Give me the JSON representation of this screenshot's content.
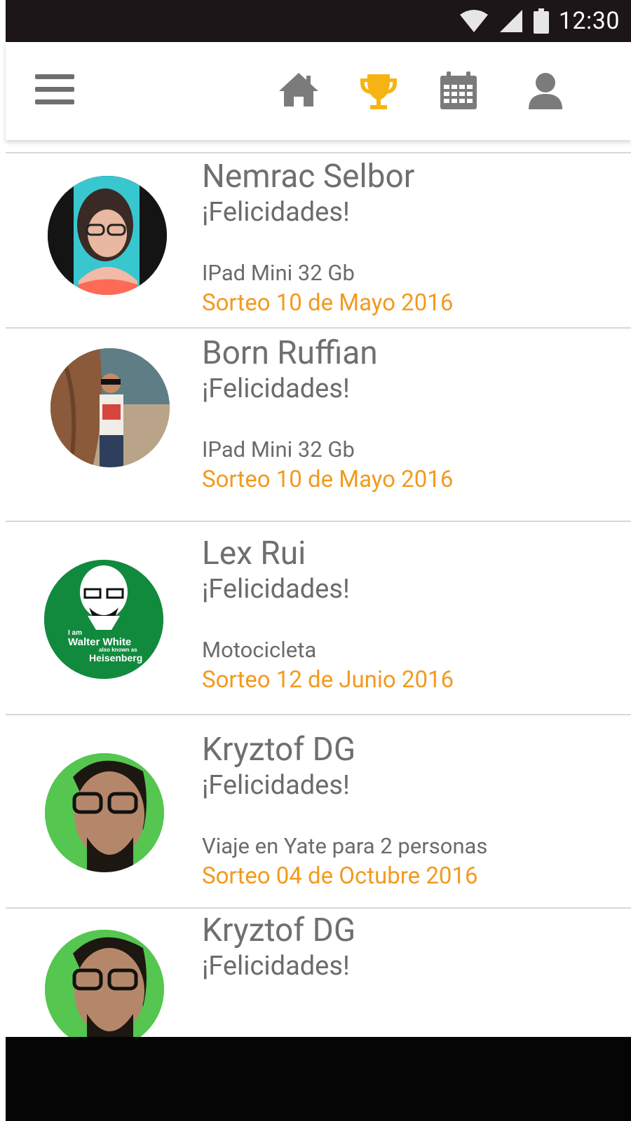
{
  "status_bar": {
    "time": "12:30"
  },
  "nav": {
    "active_tab": "winners",
    "active_color": "#f6b414",
    "inactive_color": "#7b7b7b",
    "items": [
      "menu-icon",
      "home-icon",
      "trophy-icon",
      "calendar-icon",
      "user-icon"
    ]
  },
  "winners": [
    {
      "name": "Nemrac Selbor",
      "message": "¡Felicidades!",
      "prize": "IPad Mini 32 Gb",
      "draw": "Sorteo 10 de Mayo 2016"
    },
    {
      "name": "Born Ruffian",
      "message": "¡Felicidades!",
      "prize": "IPad Mini 32 Gb",
      "draw": "Sorteo 10 de Mayo 2016"
    },
    {
      "name": "Lex Rui",
      "message": "¡Felicidades!",
      "prize": "Motocicleta",
      "draw": "Sorteo 12 de Junio 2016",
      "avatar_text": {
        "line1": "I am",
        "line2": "Walter White",
        "line3": "also known as",
        "line4": "Heisenberg"
      }
    },
    {
      "name": "Kryztof DG",
      "message": "¡Felicidades!",
      "prize": "Viaje en Yate para 2 personas",
      "draw": "Sorteo 04 de Octubre 2016"
    },
    {
      "name": "Kryztof DG",
      "message": "¡Felicidades!"
    }
  ]
}
